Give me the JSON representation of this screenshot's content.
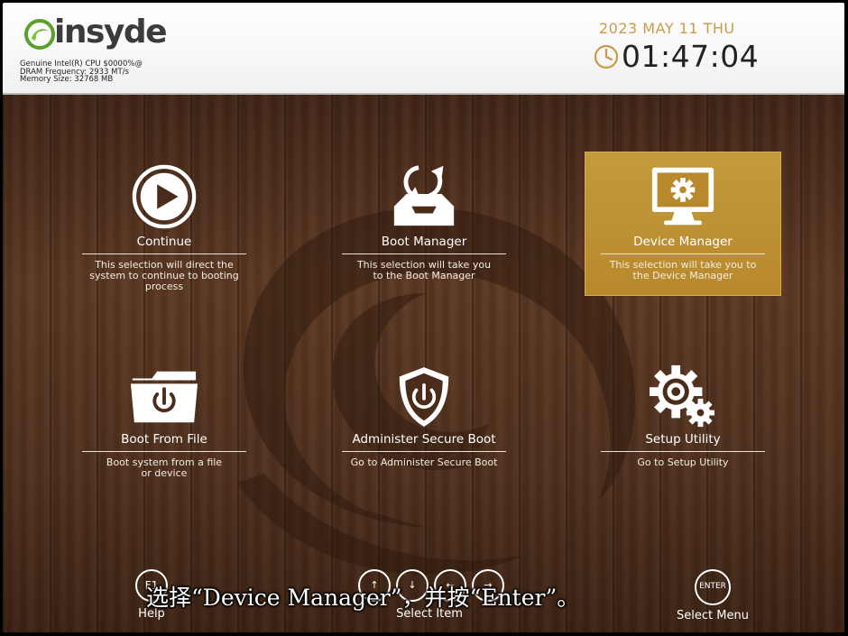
{
  "brand": {
    "logo_text": "insyde"
  },
  "system_info": {
    "cpu": "Genuine Intel(R) CPU $0000%@",
    "dram": "DRAM Frequency: 2933 MT/s",
    "memory": "Memory Size: 32768 MB"
  },
  "clock": {
    "date": "2023 MAY 11 THU",
    "time": "01:47:04"
  },
  "colors": {
    "accent_gold": "#c39a3c",
    "date_gold": "#c89b4c",
    "wood_dark": "#4e2f1d"
  },
  "menu": {
    "continue": {
      "title": "Continue",
      "description": "This selection will direct the system to continue to booting process",
      "icon": "play-icon"
    },
    "boot_manager": {
      "title": "Boot Manager",
      "description": "This selection will take you to the Boot Manager",
      "icon": "boot-manager-icon"
    },
    "device_manager": {
      "title": "Device Manager",
      "description": "This selection will take you to the Device Manager",
      "icon": "monitor-gear-icon",
      "selected": true
    },
    "boot_from_file": {
      "title": "Boot From File",
      "description": "Boot system from a file or device",
      "icon": "folder-power-icon"
    },
    "secure_boot": {
      "title": "Administer Secure Boot",
      "description": "Go to Administer Secure Boot",
      "icon": "shield-power-icon"
    },
    "setup_utility": {
      "title": "Setup Utility",
      "description": "Go to Setup Utility",
      "icon": "gears-icon"
    }
  },
  "footer": {
    "help": {
      "key": "F1",
      "label": "Help"
    },
    "select_item": {
      "label": "Select Item"
    },
    "select_menu": {
      "key": "ENTER",
      "label": "Select Menu"
    }
  },
  "subtitle": "选择“Device Manager”，并按“Enter”。"
}
